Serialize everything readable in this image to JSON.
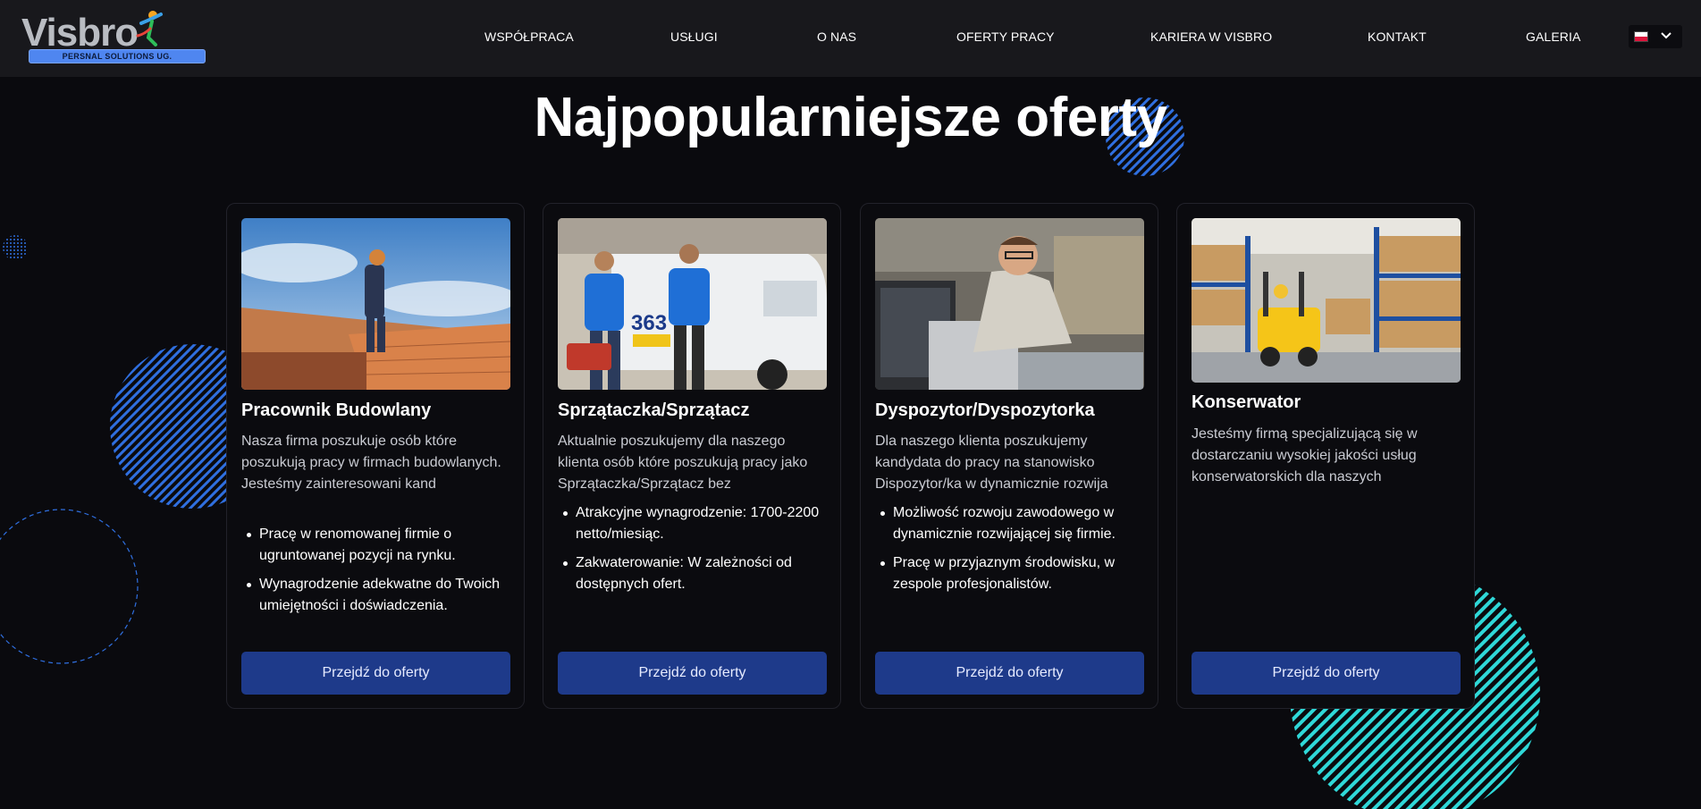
{
  "brand": {
    "name": "Visbro",
    "tagline": "PERSNAL SOLUTIONS UG."
  },
  "nav": [
    {
      "label": "WSPÓŁPRACA"
    },
    {
      "label": "USŁUGI"
    },
    {
      "label": "O NAS"
    },
    {
      "label": "OFERTY PRACY"
    },
    {
      "label": "KARIERA W VISBRO"
    },
    {
      "label": "KONTAKT"
    },
    {
      "label": "GALERIA"
    }
  ],
  "language": {
    "flag_icon": "poland-flag-icon",
    "dropdown_icon": "chevron-down-icon"
  },
  "section": {
    "title": "Najpopularniejsze oferty"
  },
  "colors": {
    "header_bg": "#18181c",
    "page_bg": "#0a0a0e",
    "button_bg": "#1e3a8a",
    "accent_blue": "#2f6fe0",
    "accent_cyan": "#2fd8d8"
  },
  "cards": [
    {
      "title": "Pracownik Budowlany",
      "description": "Nasza firma poszukuje osób które poszukują pracy w firmach budowlanych. Jesteśmy zainteresowani kand",
      "bullets": [
        "Pracę w renomowanej firmie o ugruntowanej pozycji na rynku.",
        "Wynagrodzenie adekwatne do Twoich umiejętności i doświadczenia."
      ],
      "button": "Przejdź do oferty"
    },
    {
      "title": "Sprzątaczka/Sprzątacz",
      "description": "Aktualnie poszukujemy dla naszego klienta osób które poszukują pracy jako Sprzątaczka/Sprzątacz bez",
      "bullets": [
        "Atrakcyjne wynagrodzenie: 1700-2200 netto/miesiąc.",
        "Zakwaterowanie: W zależności od dostępnych ofert."
      ],
      "button": "Przejdź do oferty"
    },
    {
      "title": "Dyspozytor/Dyspozytorka",
      "description": "Dla naszego klienta poszukujemy kandydata do pracy na stanowisko Dispozytor/ka w dynamicznie rozwija",
      "bullets": [
        "Możliwość rozwoju zawodowego w dynamicznie rozwijającej się firmie.",
        "Pracę w przyjaznym środowisku, w zespole profesjonalistów."
      ],
      "button": "Przejdź do oferty"
    },
    {
      "title": "Konserwator",
      "description": "Jesteśmy firmą specjalizującą się w dostarczaniu wysokiej jakości usług konserwatorskich dla naszych",
      "bullets": [],
      "button": "Przejdź do oferty"
    }
  ]
}
